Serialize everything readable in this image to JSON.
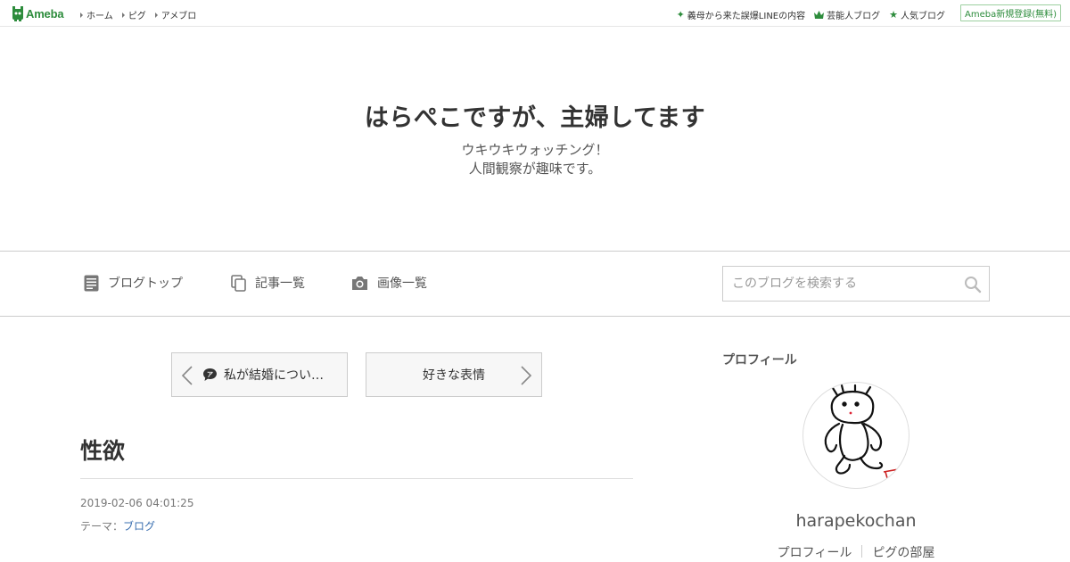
{
  "header": {
    "logo_text": "Ameba",
    "nav": [
      "ホーム",
      "ピグ",
      "アメブロ"
    ],
    "right_links": [
      {
        "icon": "sparkle-icon",
        "label": "義母から来た誤爆LINEの内容"
      },
      {
        "icon": "crown-icon",
        "label": "芸能人ブログ"
      },
      {
        "icon": "star-icon",
        "label": "人気ブログ"
      }
    ],
    "register_label": "Ameba新規登録(無料)",
    "accent_color": "#2d8c3c"
  },
  "blog": {
    "title": "はらぺこですが、主婦してます",
    "description_line1": "ウキウキウォッチング！",
    "description_line2": "人間観察が趣味です。"
  },
  "navbar": {
    "blog_top": "ブログトップ",
    "article_list": "記事一覧",
    "image_list": "画像一覧",
    "search_placeholder": "このブログを検索する"
  },
  "pager": {
    "prev_label": "私が結婚につい…",
    "next_label": "好きな表情"
  },
  "article": {
    "title": "性欲",
    "date": "2019-02-06 04:01:25",
    "theme_prefix": "テーマ：",
    "theme": "ブログ"
  },
  "sidebar": {
    "profile_heading": "プロフィール",
    "username": "harapekochan",
    "links": [
      "プロフィール",
      "ピグの部屋"
    ]
  }
}
